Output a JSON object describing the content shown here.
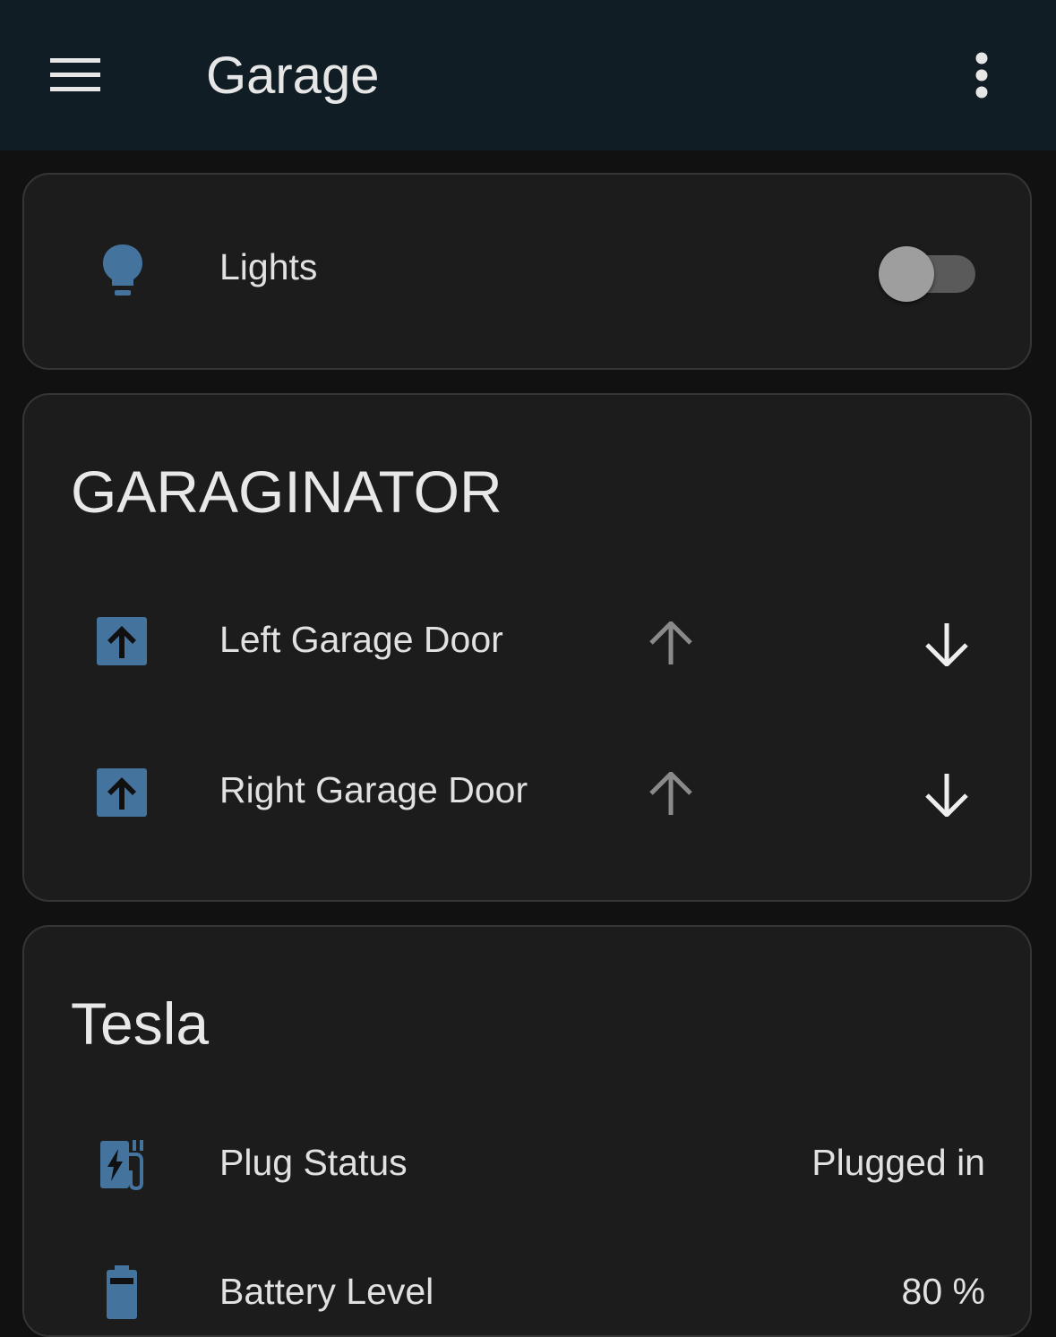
{
  "header": {
    "title": "Garage",
    "menu_icon": "hamburger-menu-icon",
    "more_icon": "more-vertical-icon"
  },
  "lights_card": {
    "label": "Lights",
    "icon": "lightbulb-icon",
    "state": "off"
  },
  "garage_card": {
    "title": "GARAGINATOR",
    "doors": [
      {
        "label": "Left Garage Door",
        "icon": "garage-door-open-icon",
        "open_icon": "arrow-up-icon",
        "close_icon": "arrow-down-icon"
      },
      {
        "label": "Right Garage Door",
        "icon": "garage-door-open-icon",
        "open_icon": "arrow-up-icon",
        "close_icon": "arrow-down-icon"
      }
    ]
  },
  "tesla_card": {
    "title": "Tesla",
    "rows": [
      {
        "label": "Plug Status",
        "value": "Plugged in",
        "icon": "ev-station-icon"
      },
      {
        "label": "Battery Level",
        "value": "80 %",
        "icon": "battery-icon"
      }
    ]
  },
  "colors": {
    "header_bg": "#111d24",
    "page_bg": "#111111",
    "card_bg": "#1c1c1c",
    "icon_blue": "#44739e",
    "text": "#e1e1e1",
    "disabled_arrow": "#8a8a8a"
  }
}
